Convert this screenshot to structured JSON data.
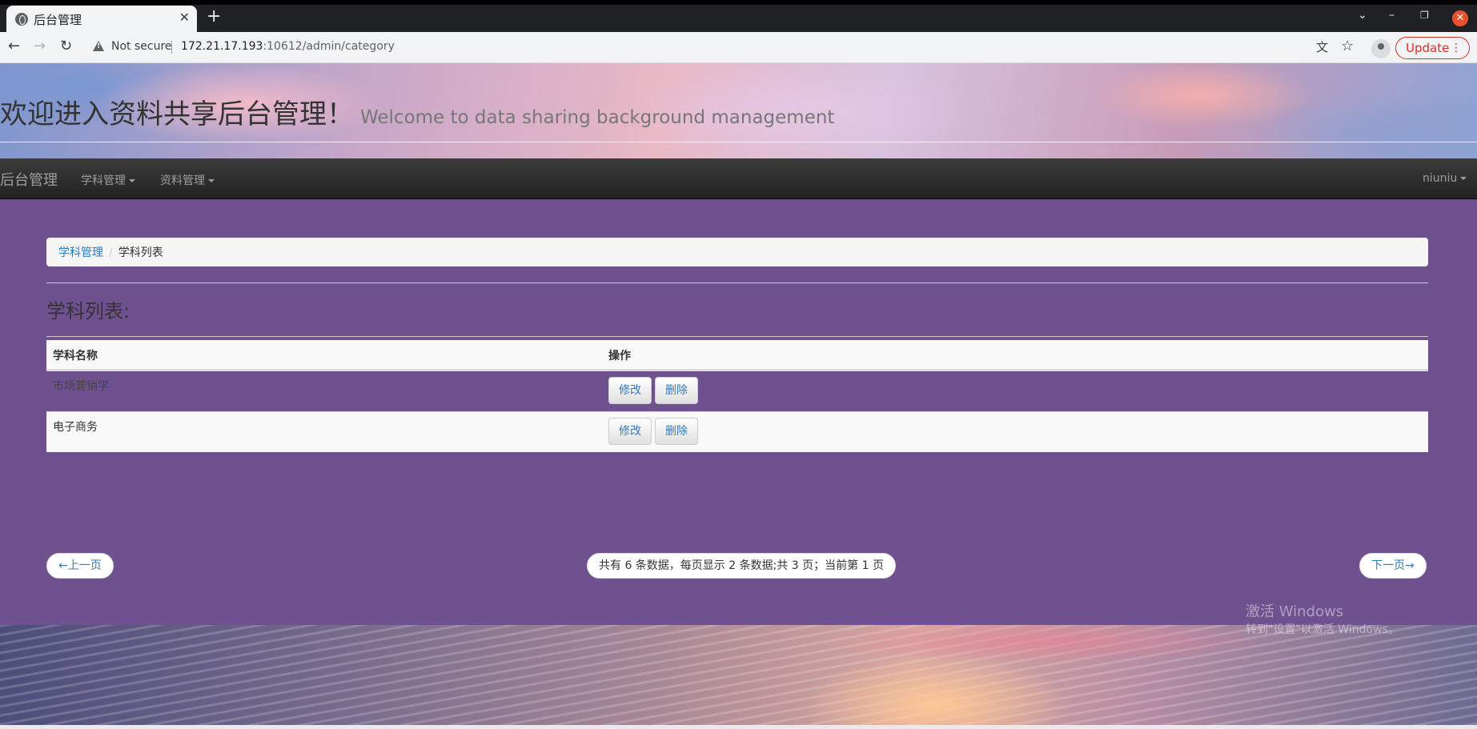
{
  "browser": {
    "tab_title": "后台管理",
    "tab_close": "✕",
    "new_tab": "+",
    "not_secure": "Not secure",
    "url_host": "172.21.17.193",
    "url_rest": ":10612/admin/category",
    "update_label": "Update",
    "menu_dots": "⋮"
  },
  "banner": {
    "title": "欢迎进入资料共享后台管理！",
    "subtitle": "Welcome to data sharing background management"
  },
  "navbar": {
    "brand": "后台管理",
    "menu_subject": "学科管理",
    "menu_material": "资料管理",
    "user": "niuniu"
  },
  "breadcrumb": {
    "parent": "学科管理",
    "separator": "/",
    "current": "学科列表"
  },
  "section_title": "学科列表:",
  "table": {
    "headers": [
      "学科名称",
      "操作"
    ],
    "rows": [
      {
        "name": "市场营销学",
        "edit": "修改",
        "delete": "删除"
      },
      {
        "name": "电子商务",
        "edit": "修改",
        "delete": "删除"
      }
    ]
  },
  "pagination": {
    "prev": "←上一页",
    "info": "共有 6 条数据，每页显示 2 条数据;共 3 页；当前第 1 页",
    "next": "下一页→"
  },
  "watermark": {
    "line1": "激活 Windows",
    "line2": "转到\"设置\"以激活 Windows。"
  }
}
